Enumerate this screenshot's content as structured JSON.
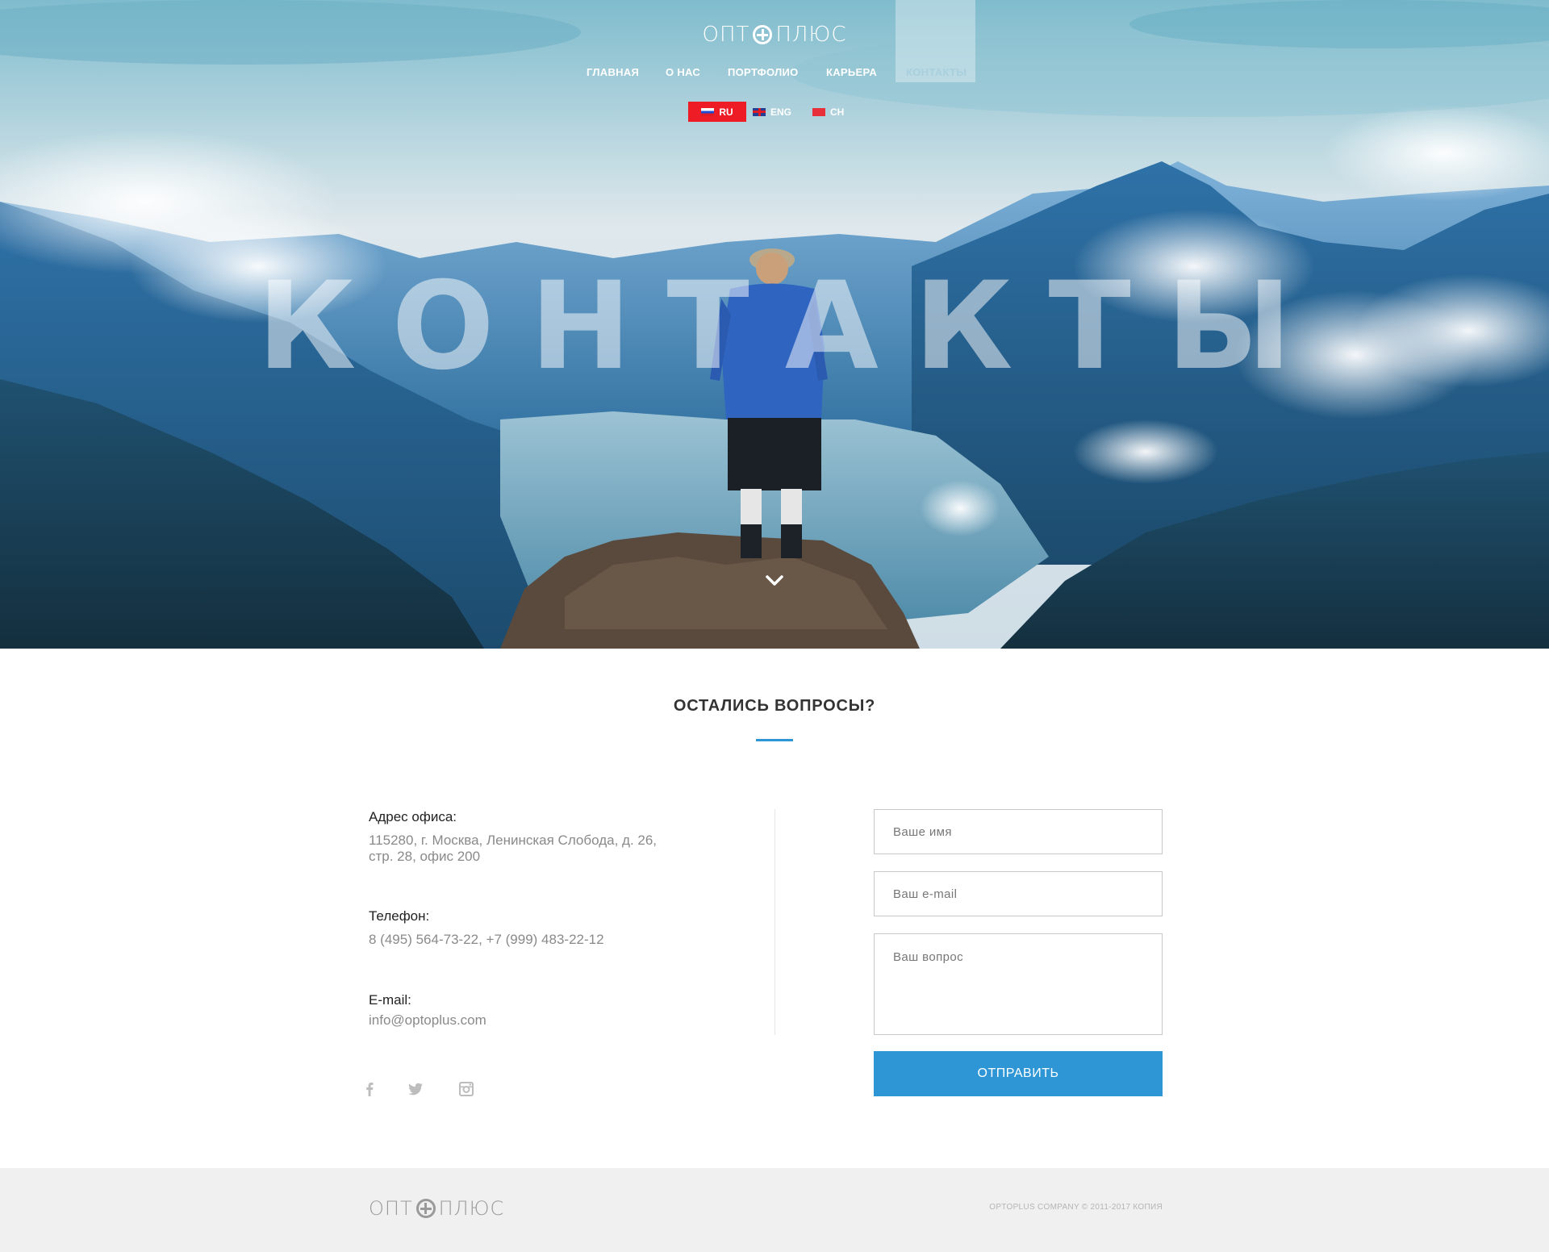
{
  "brand": {
    "logo_left": "ОПТ",
    "logo_right": "ПЛЮС"
  },
  "nav": {
    "items": [
      {
        "label": "ГЛАВНАЯ"
      },
      {
        "label": "О НАС"
      },
      {
        "label": "ПОРТФОЛИО"
      },
      {
        "label": "КАРЬЕРА"
      },
      {
        "label": "КОНТАКТЫ"
      }
    ],
    "active": "КОНТАКТЫ"
  },
  "languages": [
    {
      "code": "RU",
      "flag": "flag-ru-icon",
      "active": true
    },
    {
      "code": "ENG",
      "flag": "flag-uk-icon",
      "active": false
    },
    {
      "code": "CH",
      "flag": "flag-cn-icon",
      "active": false
    }
  ],
  "hero": {
    "title": "КОНТАКТЫ",
    "scroll_icon": "chevron-down-icon"
  },
  "contact": {
    "heading": "ОСТАЛИСЬ ВОПРОСЫ?",
    "address_label": "Адрес офиса:",
    "address_line1": "115280, г. Москва, Ленинская Слобода, д. 26,",
    "address_line2": "стр. 28, офис 200",
    "phone_label": "Телефон:",
    "phone_value": "8 (495) 564-73-22, +7 (999) 483-22-12",
    "email_label": "E-mail:",
    "email_value": "info@optoplus.com",
    "social": [
      "facebook-icon",
      "twitter-icon",
      "instagram-icon"
    ]
  },
  "form": {
    "name_placeholder": "Ваше имя",
    "email_placeholder": "Ваш e-mail",
    "question_placeholder": "Ваш вопрос",
    "submit_label": "ОТПРАВИТЬ"
  },
  "footer": {
    "copyright": "OPTOPLUS COMPANY © 2011-2017 КОПИЯ"
  },
  "colors": {
    "accent": "#2f96d6",
    "lang_active": "#ee1c24",
    "footer_bg": "#f0f0f0"
  }
}
